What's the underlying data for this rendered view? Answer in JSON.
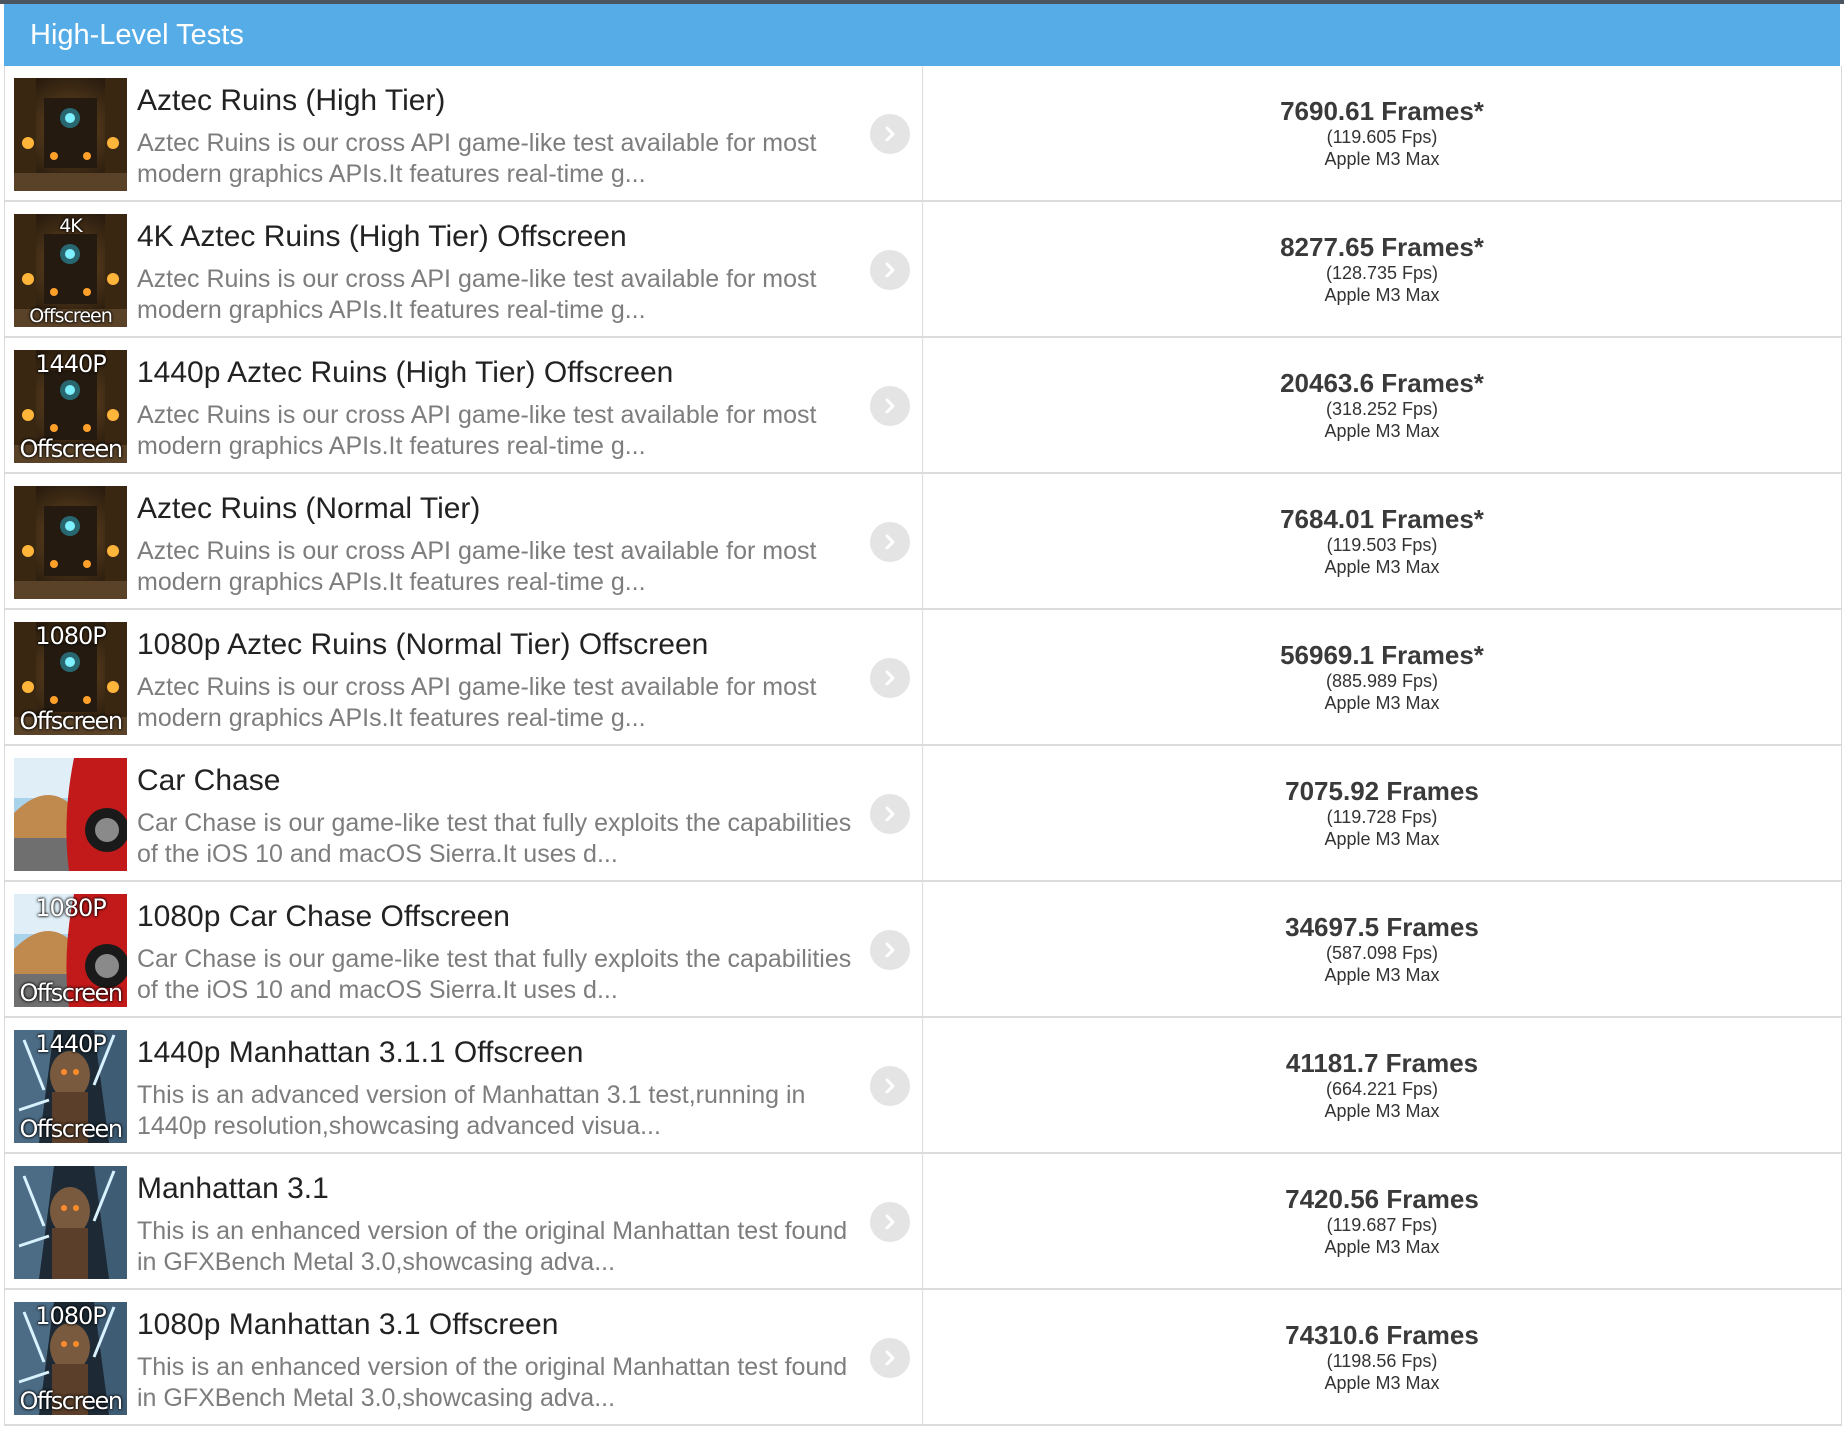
{
  "header": {
    "title": "High-Level Tests"
  },
  "tests": [
    {
      "name": "Aztec Ruins (High Tier)",
      "description": "Aztec Ruins is our cross API game-like test available for most modern graphics APIs.It features real-time g...",
      "score": "7690.61 Frames*",
      "fps": "(119.605 Fps)",
      "device": "Apple M3 Max",
      "thumb": {
        "scene": "aztec",
        "top": "",
        "bottom": ""
      }
    },
    {
      "name": "4K Aztec Ruins (High Tier) Offscreen",
      "description": "Aztec Ruins is our cross API game-like test available for most modern graphics APIs.It features real-time g...",
      "score": "8277.65 Frames*",
      "fps": "(128.735 Fps)",
      "device": "Apple M3 Max",
      "thumb": {
        "scene": "aztec",
        "top": "4K",
        "bottom": "Offscreen",
        "small": true
      }
    },
    {
      "name": "1440p Aztec Ruins (High Tier) Offscreen",
      "description": "Aztec Ruins is our cross API game-like test available for most modern graphics APIs.It features real-time g...",
      "score": "20463.6 Frames*",
      "fps": "(318.252 Fps)",
      "device": "Apple M3 Max",
      "thumb": {
        "scene": "aztec",
        "top": "1440P",
        "bottom": "Offscreen"
      }
    },
    {
      "name": "Aztec Ruins (Normal Tier)",
      "description": "Aztec Ruins is our cross API game-like test available for most modern graphics APIs.It features real-time g...",
      "score": "7684.01 Frames*",
      "fps": "(119.503 Fps)",
      "device": "Apple M3 Max",
      "thumb": {
        "scene": "aztec",
        "top": "",
        "bottom": ""
      }
    },
    {
      "name": "1080p Aztec Ruins (Normal Tier) Offscreen",
      "description": "Aztec Ruins is our cross API game-like test available for most modern graphics APIs.It features real-time g...",
      "score": "56969.1 Frames*",
      "fps": "(885.989 Fps)",
      "device": "Apple M3 Max",
      "thumb": {
        "scene": "aztec",
        "top": "1080P",
        "bottom": "Offscreen"
      }
    },
    {
      "name": "Car Chase",
      "description": "Car Chase is our game-like test that fully exploits the capabilities of the iOS 10 and macOS Sierra.It uses d...",
      "score": "7075.92 Frames",
      "fps": "(119.728 Fps)",
      "device": "Apple M3 Max",
      "thumb": {
        "scene": "car",
        "top": "",
        "bottom": ""
      }
    },
    {
      "name": "1080p Car Chase Offscreen",
      "description": "Car Chase is our game-like test that fully exploits the capabilities of the iOS 10 and macOS Sierra.It uses d...",
      "score": "34697.5 Frames",
      "fps": "(587.098 Fps)",
      "device": "Apple M3 Max",
      "thumb": {
        "scene": "car",
        "top": "1080P",
        "bottom": "Offscreen"
      }
    },
    {
      "name": "1440p Manhattan 3.1.1 Offscreen",
      "description": "This is an advanced version of Manhattan 3.1 test,running in 1440p resolution,showcasing advanced visua...",
      "score": "41181.7 Frames",
      "fps": "(664.221 Fps)",
      "device": "Apple M3 Max",
      "thumb": {
        "scene": "manhattan",
        "top": "1440P",
        "bottom": "Offscreen"
      }
    },
    {
      "name": "Manhattan 3.1",
      "description": "This is an enhanced version of the original Manhattan test found in GFXBench Metal 3.0,showcasing adva...",
      "score": "7420.56 Frames",
      "fps": "(119.687 Fps)",
      "device": "Apple M3 Max",
      "thumb": {
        "scene": "manhattan",
        "top": "",
        "bottom": ""
      }
    },
    {
      "name": "1080p Manhattan 3.1 Offscreen",
      "description": "This is an enhanced version of the original Manhattan test found in GFXBench Metal 3.0,showcasing adva...",
      "score": "74310.6 Frames",
      "fps": "(1198.56 Fps)",
      "device": "Apple M3 Max",
      "thumb": {
        "scene": "manhattan",
        "top": "1080P",
        "bottom": "Offscreen"
      }
    }
  ]
}
